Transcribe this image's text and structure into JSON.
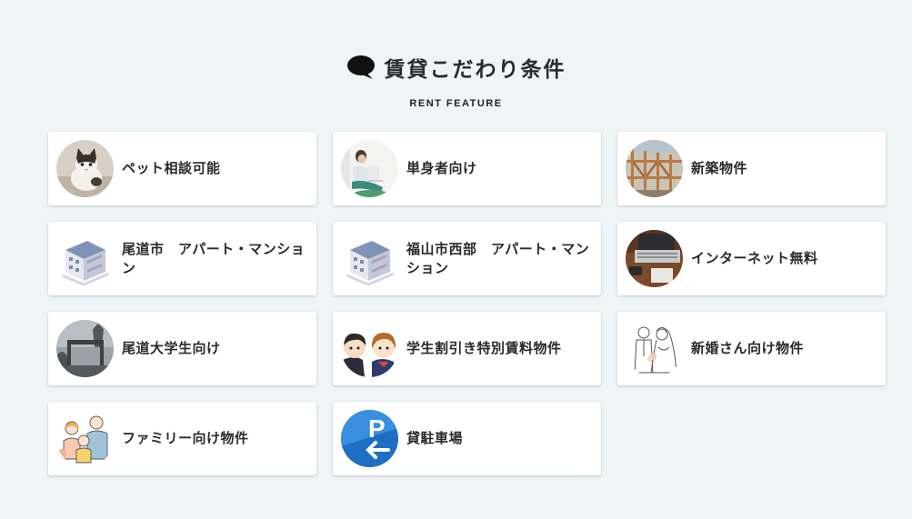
{
  "section": {
    "title": "賃貸こだわり条件",
    "subtitle": "RENT FEATURE"
  },
  "features": [
    {
      "label": "ペット相談可能",
      "icon": "pet-cat-photo"
    },
    {
      "label": "単身者向け",
      "icon": "single-person-photo"
    },
    {
      "label": "新築物件",
      "icon": "new-construction-photo"
    },
    {
      "label": "尾道市　アパート・マンション",
      "icon": "apartment-building-illustration"
    },
    {
      "label": "福山市西部　アパート・マンション",
      "icon": "apartment-building-illustration"
    },
    {
      "label": "インターネット無料",
      "icon": "laptop-photo"
    },
    {
      "label": "尾道大学生向け",
      "icon": "university-gate-photo"
    },
    {
      "label": "学生割引き特別賃料物件",
      "icon": "students-illustration"
    },
    {
      "label": "新婚さん向け物件",
      "icon": "newlyweds-illustration"
    },
    {
      "label": "ファミリー向け物件",
      "icon": "family-illustration"
    },
    {
      "label": "貸駐車場",
      "icon": "parking-sign-photo"
    }
  ],
  "colors": {
    "background": "#eff4f7",
    "card": "#ffffff",
    "text": "#2a2a2a"
  }
}
